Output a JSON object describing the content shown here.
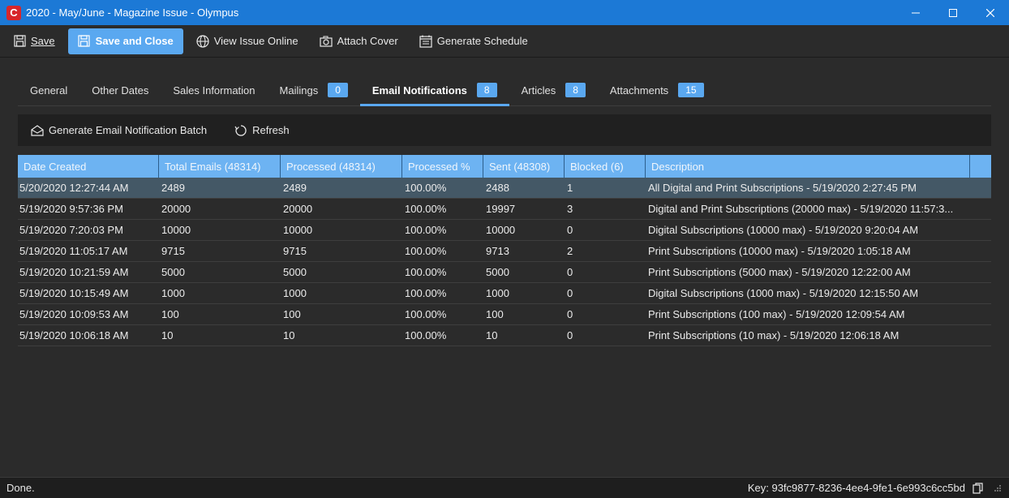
{
  "window": {
    "title": "2020 - May/June - Magazine Issue - Olympus",
    "logo_letter": "C"
  },
  "toolbar": {
    "save": "Save",
    "save_and_close": "Save and Close",
    "view_issue_online": "View Issue Online",
    "attach_cover": "Attach Cover",
    "generate_schedule": "Generate Schedule"
  },
  "tabs": [
    {
      "label": "General"
    },
    {
      "label": "Other Dates"
    },
    {
      "label": "Sales Information"
    },
    {
      "label": "Mailings",
      "badge": "0"
    },
    {
      "label": "Email Notifications",
      "badge": "8"
    },
    {
      "label": "Articles",
      "badge": "8"
    },
    {
      "label": "Attachments",
      "badge": "15"
    }
  ],
  "actions": {
    "generate_batch": "Generate Email Notification Batch",
    "refresh": "Refresh"
  },
  "grid": {
    "columns": [
      "Date Created",
      "Total Emails (48314)",
      "Processed (48314)",
      "Processed %",
      "Sent (48308)",
      "Blocked (6)",
      "Description"
    ],
    "rows": [
      [
        "5/20/2020 12:27:44 AM",
        "2489",
        "2489",
        "100.00%",
        "2488",
        "1",
        "All Digital and Print Subscriptions - 5/19/2020 2:27:45 PM"
      ],
      [
        "5/19/2020 9:57:36 PM",
        "20000",
        "20000",
        "100.00%",
        "19997",
        "3",
        "Digital and Print Subscriptions (20000 max) - 5/19/2020 11:57:3..."
      ],
      [
        "5/19/2020 7:20:03 PM",
        "10000",
        "10000",
        "100.00%",
        "10000",
        "0",
        "Digital Subscriptions (10000 max) - 5/19/2020 9:20:04 AM"
      ],
      [
        "5/19/2020 11:05:17 AM",
        "9715",
        "9715",
        "100.00%",
        "9713",
        "2",
        "Print Subscriptions (10000 max) - 5/19/2020 1:05:18 AM"
      ],
      [
        "5/19/2020 10:21:59 AM",
        "5000",
        "5000",
        "100.00%",
        "5000",
        "0",
        "Print Subscriptions (5000 max) - 5/19/2020 12:22:00 AM"
      ],
      [
        "5/19/2020 10:15:49 AM",
        "1000",
        "1000",
        "100.00%",
        "1000",
        "0",
        "Digital Subscriptions (1000 max) - 5/19/2020 12:15:50 AM"
      ],
      [
        "5/19/2020 10:09:53 AM",
        "100",
        "100",
        "100.00%",
        "100",
        "0",
        "Print Subscriptions (100 max) - 5/19/2020 12:09:54 AM"
      ],
      [
        "5/19/2020 10:06:18 AM",
        "10",
        "10",
        "100.00%",
        "10",
        "0",
        "Print Subscriptions (10 max) - 5/19/2020 12:06:18 AM"
      ]
    ]
  },
  "status": {
    "left": "Done.",
    "key": "Key: 93fc9877-8236-4ee4-9fe1-6e993c6cc5bd"
  },
  "colors": {
    "titlebar": "#1c79d6",
    "accent": "#5aa8f0",
    "grid_header": "#6db3f2",
    "selected_row": "#445866"
  }
}
